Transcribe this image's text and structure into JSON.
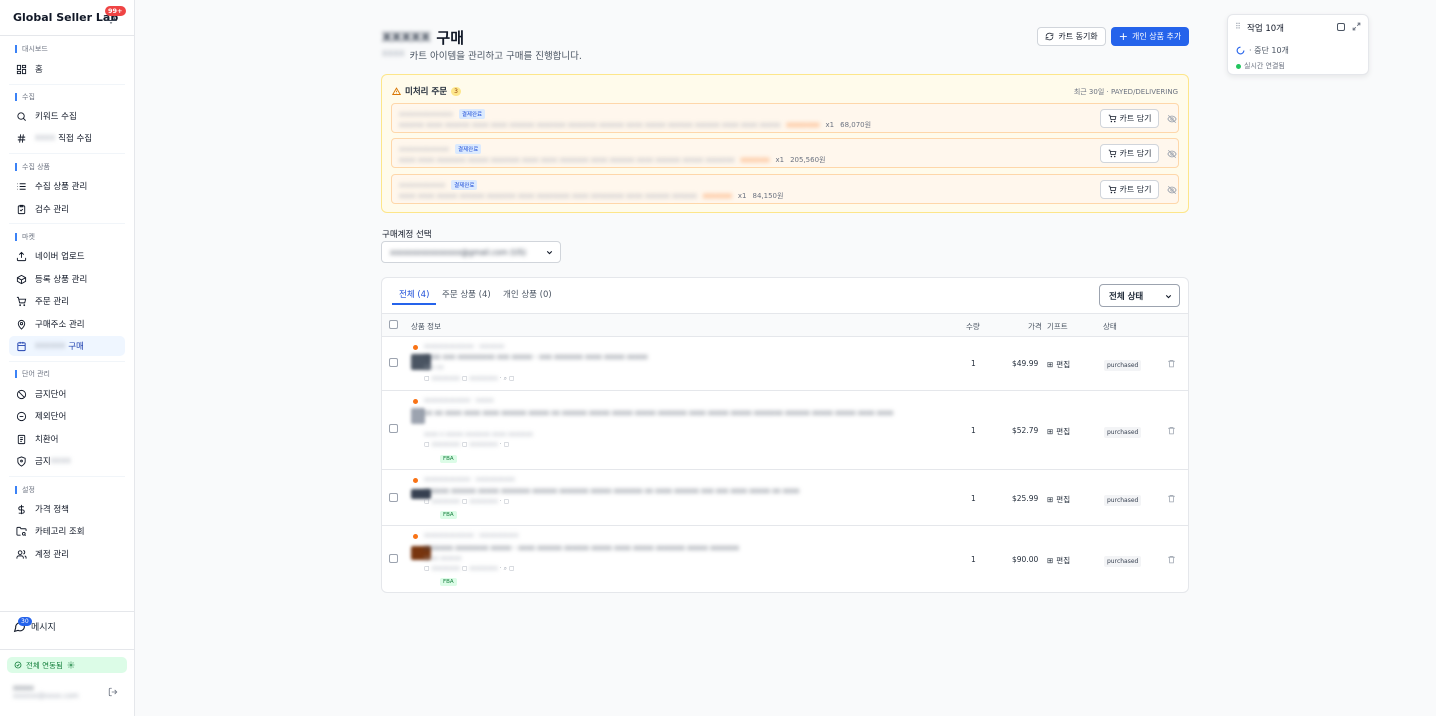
{
  "brand": {
    "title": "Global Seller Lab",
    "notif_count": "99+"
  },
  "sidebar": {
    "sections": [
      {
        "label": "대시보드",
        "items": [
          {
            "label": "홈",
            "icon": "grid-icon"
          }
        ]
      },
      {
        "label": "수집",
        "items": [
          {
            "label": "키워드 수집",
            "icon": "search-icon"
          },
          {
            "label": "직접 수집",
            "icon": "hash-icon",
            "blurred_prefix": "xxxx"
          }
        ]
      },
      {
        "label": "수집 상품",
        "items": [
          {
            "label": "수집 상품 관리",
            "icon": "list-icon"
          },
          {
            "label": "검수 관리",
            "icon": "clipboard-check-icon"
          }
        ]
      },
      {
        "label": "마켓",
        "items": [
          {
            "label": "네이버 업로드",
            "icon": "upload-icon"
          },
          {
            "label": "등록 상품 관리",
            "icon": "box-icon"
          },
          {
            "label": "주문 관리",
            "icon": "cart-icon"
          },
          {
            "label": "구매주소 관리",
            "icon": "map-pin-icon"
          },
          {
            "label": "구매",
            "icon": "calendar-icon",
            "blurred_prefix": "xxxxxx",
            "active": true
          }
        ]
      },
      {
        "label": "단어 관리",
        "items": [
          {
            "label": "금지단어",
            "icon": "ban-icon"
          },
          {
            "label": "제외단어",
            "icon": "minus-circle-icon"
          },
          {
            "label": "치환어",
            "icon": "replace-icon"
          },
          {
            "label": "금지",
            "icon": "shield-icon",
            "blurred_suffix": "xxxx"
          }
        ]
      },
      {
        "label": "설정",
        "items": [
          {
            "label": "가격 정책",
            "icon": "dollar-icon"
          },
          {
            "label": "카테고리 조회",
            "icon": "folder-search-icon"
          },
          {
            "label": "계정 관리",
            "icon": "users-icon"
          }
        ]
      }
    ],
    "message": {
      "label": "메시지",
      "count": "30"
    },
    "sync_status": "전체 연동됨",
    "user": {
      "name": "xxxxx",
      "email": "xxxxxx@xxxx.com"
    }
  },
  "header": {
    "title_prefix": "xxxxx",
    "title": "구매",
    "subtitle_prefix": "xxxx",
    "subtitle": "카트 아이템을 관리하고 구매를 진행합니다.",
    "sync_button": "카트 동기화",
    "add_button": "개인 상품 추가"
  },
  "pending": {
    "title": "미처리 주문",
    "count": "3",
    "meta": "최근 30일 · PAYED/DELIVERING",
    "rows": [
      {
        "id": "xxxxxxxxxxxxxx",
        "status": "결제완료",
        "desc": "xxxxxx xxxx xxxxxx xxxx xxxx xxxxxx xxxxxxx xxxxxxx xxxxxx xxxx xxxxx xxxxxx xxxxxx xxxx xxxx xxxxx",
        "code": "xxxxxxxx",
        "qty": "x1",
        "price": "68,070원",
        "cart_label": "카트 담기"
      },
      {
        "id": "xxxxxxxxxxxxx",
        "status": "결제완료",
        "desc": "xxxx xxxx xxxxxxx xxxxx xxxxxxx xxxx xxxx xxxxxxx xxxx xxxxxx xxxx xxxxxx xxxxx xxxxxxx",
        "code": "xxxxxxx",
        "qty": "x1",
        "price": "205,560원",
        "cart_label": "카트 담기"
      },
      {
        "id": "xxxxxxxxxxxx",
        "status": "결제완료",
        "desc": "xxxx xxxx xxxxx xxxxxx xxxxxxx xxxx xxxxxxxx xxxx xxxxxxxx xxxx xxxxxx xxxxxx",
        "code": "xxxxxxx",
        "qty": "x1",
        "price": "84,150원",
        "cart_label": "카트 담기"
      }
    ]
  },
  "account": {
    "label": "구매계정 선택",
    "value": "xxxxxxxxxxxxxxxx@gmail.com (US)"
  },
  "tabs": [
    {
      "label": "전체 (4)",
      "active": true
    },
    {
      "label": "주문 상품 (4)"
    },
    {
      "label": "개인 상품 (0)"
    }
  ],
  "status_filter": "전체 상태",
  "table": {
    "headers": {
      "info": "상품 정보",
      "qty": "수량",
      "price": "가격",
      "gift": "기프트",
      "status": "상태"
    },
    "edit_label": "편집",
    "rows": [
      {
        "id": "xxxxxxxxxxxxxx",
        "vendor": "xxxxxxx",
        "title": "xxxx xxx xxxxxxxxx xxx xxxxx - xxx xxxxxxx xxxx xxxxx xxxxx",
        "variant": "xxx xx",
        "qty": "1",
        "price": "$49.99",
        "status": "purchased",
        "fba": false
      },
      {
        "id": "xxxxxxxxxxxxx",
        "vendor": "xxxxx",
        "title": "xx xx xxxx xxxx xxxx xxxxxx xxxxx xx xxxxxx xxxxx xxxxx xxxxx xxxxxxx xxxx xxxxx xxxxx xxxxxxx xxxxxx xxxxx xxxxx xxxx xxxx",
        "variant": "xxxx x xxxxx xxxxxxx xxxx xxxxxxx",
        "qty": "1",
        "price": "$52.79",
        "status": "purchased",
        "fba": true,
        "fba_label": "FBA"
      },
      {
        "id": "xxxxxxxxxxxxx",
        "vendor": "xxxxxxxxxxx",
        "title": "xxxxxx xxxxxx xxxxx xxxxxxx xxxxxx xxxxxxx xxxxx xxxxxxx xx xxxx xxxxxx xxx xxx xxxx xxxxx xx xxxx",
        "variant": "",
        "qty": "1",
        "price": "$25.99",
        "status": "purchased",
        "fba": true,
        "fba_label": "FBA"
      },
      {
        "id": "xxxxxxxxxxxxxx",
        "vendor": "xxxxxxxxxxx",
        "title": "xxxxxxx xxxxxxxx xxxxx - xxxx xxxxxx xxxxxx xxxxx xxxx xxxxx xxxxxxx xxxxx xxxxxxx",
        "variant": "xxxx xxxxxx",
        "qty": "1",
        "price": "$90.00",
        "status": "purchased",
        "fba": true,
        "fba_label": "FBA"
      }
    ]
  },
  "task_panel": {
    "title": "작업 10개",
    "line": "· 중단 10개",
    "live": "실시간 연결됨"
  },
  "colors": {
    "primary": "#2563eb",
    "warning_bg": "#fffbeb",
    "success": "#22c55e"
  }
}
